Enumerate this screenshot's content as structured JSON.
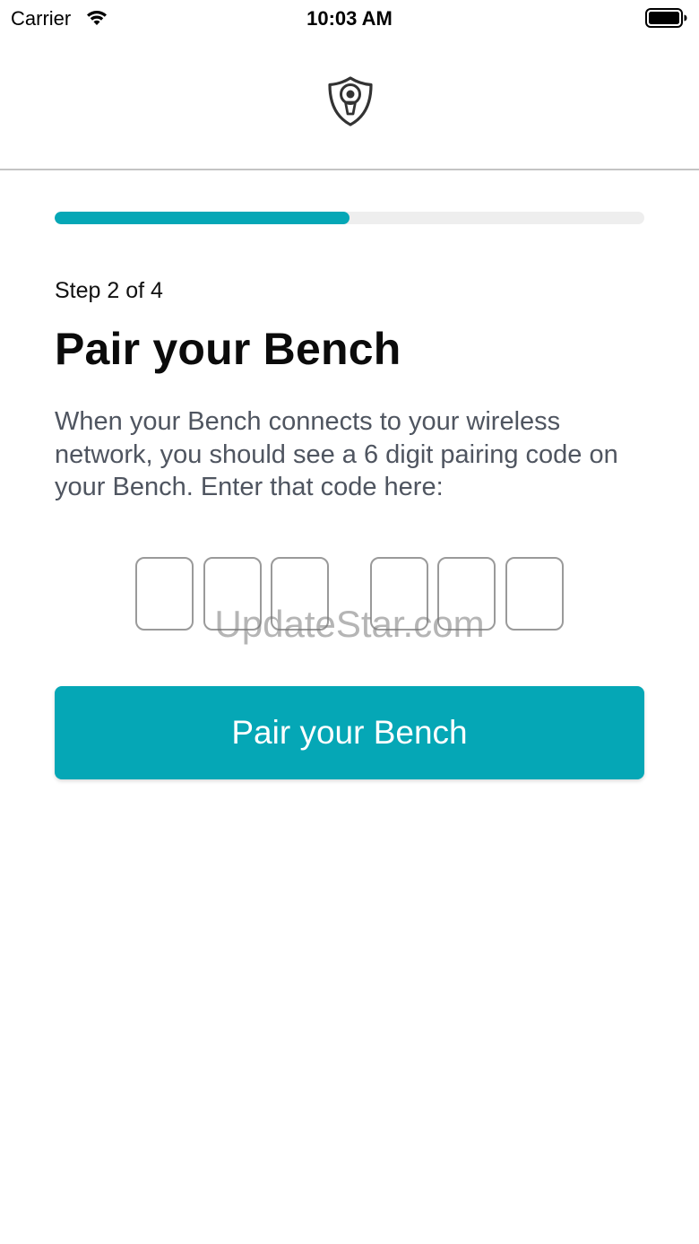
{
  "status_bar": {
    "carrier": "Carrier",
    "time": "10:03 AM",
    "wifi_icon": "wifi-icon",
    "battery_icon": "battery-full-icon"
  },
  "header": {
    "logo_icon": "shield-keyhole-icon"
  },
  "progress": {
    "percent": 50,
    "accent_color": "#05a7b6",
    "track_color": "#eeeeee"
  },
  "content": {
    "step_label": "Step 2 of 4",
    "title": "Pair your Bench",
    "instructions": "When your Bench connects to your wireless network, you should see a 6 digit pairing code on your Bench. Enter that code here:"
  },
  "code_inputs": {
    "digits": [
      "",
      "",
      "",
      "",
      "",
      ""
    ]
  },
  "watermark": "UpdateStar.com",
  "pair_button": {
    "label": "Pair your Bench",
    "color": "#05a7b6"
  }
}
